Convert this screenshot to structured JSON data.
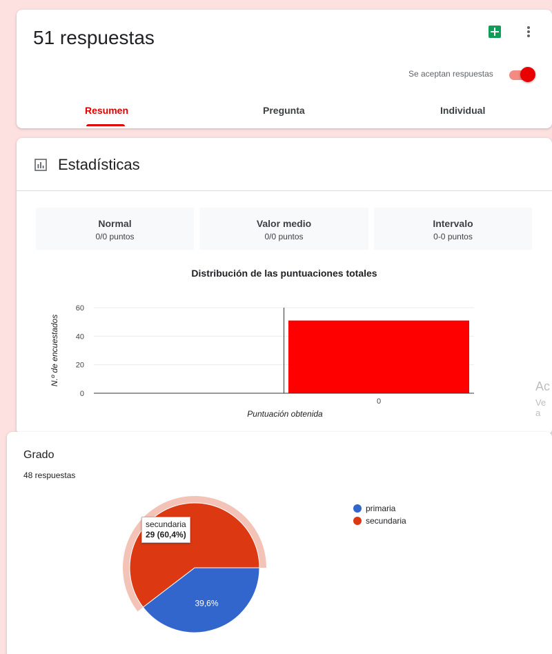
{
  "header": {
    "title": "51 respuestas",
    "accepting_label": "Se aceptan respuestas",
    "accepting": true,
    "icons": [
      "sheets-icon",
      "more-vert-icon"
    ],
    "tabs": [
      {
        "label": "Resumen",
        "active": true
      },
      {
        "label": "Pregunta",
        "active": false
      },
      {
        "label": "Individual",
        "active": false
      }
    ],
    "accent_color": "#e00000"
  },
  "stats": {
    "title": "Estadísticas",
    "icon": "bar-chart-icon",
    "boxes": [
      {
        "label": "Normal",
        "value": "0/0 puntos"
      },
      {
        "label": "Valor medio",
        "value": "0/0 puntos"
      },
      {
        "label": "Intervalo",
        "value": "0-0 puntos"
      }
    ],
    "watermark": {
      "line1": "Ac",
      "line2": "Ve a"
    }
  },
  "grado": {
    "title": "Grado",
    "count": "48 respuestas",
    "tooltip_label": "secundaria",
    "tooltip_value": "29 (60,4%)"
  },
  "chart_data": [
    {
      "type": "bar",
      "title": "Distribución de las puntuaciones totales",
      "xlabel": "Puntuación obtenida",
      "ylabel": "N.º de encuestados",
      "categories": [
        "0"
      ],
      "values": [
        51
      ],
      "ylim": [
        0,
        60
      ],
      "yticks": [
        "0",
        "20",
        "40",
        "60"
      ],
      "grid": true,
      "color": "#ff0000"
    },
    {
      "type": "pie",
      "slices": [
        {
          "label": "primaria",
          "value": 39.6,
          "display": "39,6%",
          "color": "#3366cc"
        },
        {
          "label": "secundaria",
          "value": 60.4,
          "display": "60,4%",
          "color": "#dc3912"
        }
      ],
      "highlighted": "secundaria",
      "legend": "right"
    }
  ]
}
